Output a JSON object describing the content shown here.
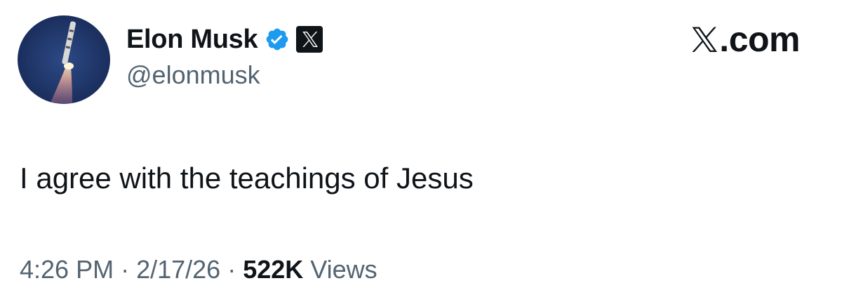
{
  "author": {
    "display_name": "Elon Musk",
    "handle": "@elonmusk",
    "verified_icon": "verified-badge-icon",
    "affiliate_icon": "x-logo-icon",
    "avatar_icon": "rocket-launch-avatar"
  },
  "brand": {
    "logo_icon": "x-logo-icon",
    "suffix": ".com"
  },
  "tweet": {
    "text": "I agree with the teachings of Jesus"
  },
  "meta": {
    "time": "4:26 PM",
    "separator": "·",
    "date": "2/17/26",
    "views_count": "522K",
    "views_label": "Views"
  },
  "colors": {
    "text_primary": "#0f1419",
    "text_secondary": "#536471",
    "verified_blue": "#1d9bf0",
    "background": "#ffffff"
  }
}
